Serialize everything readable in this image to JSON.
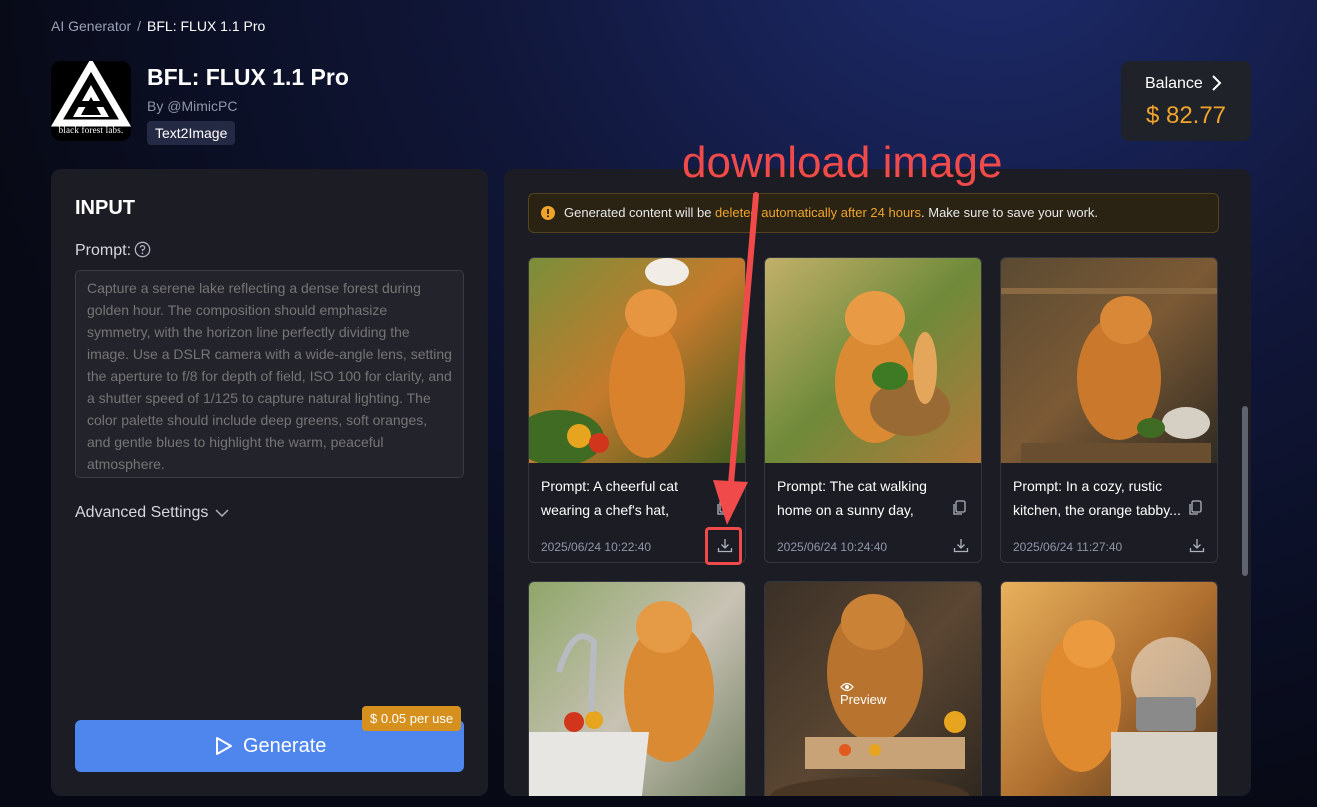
{
  "breadcrumb": {
    "parent": "AI Generator",
    "separator": "/",
    "current": "BFL: FLUX 1.1 Pro"
  },
  "app": {
    "title": "BFL: FLUX 1.1 Pro",
    "author": "By @MimicPC",
    "tag": "Text2Image",
    "logo_text": "black forest labs."
  },
  "balance": {
    "label": "Balance",
    "value": "$ 82.77",
    "icon": "chevron-right-icon"
  },
  "input": {
    "heading": "INPUT",
    "prompt_label": "Prompt:",
    "prompt_placeholder": "Capture a serene lake reflecting a dense forest during golden hour. The composition should emphasize symmetry, with the horizon line perfectly dividing the image. Use a DSLR camera with a wide-angle lens, setting the aperture to f/8 for depth of field, ISO 100 for clarity, and a shutter speed of 1/125 to capture natural lighting. The color palette should include deep greens, soft oranges, and gentle blues to highlight the warm, peaceful atmosphere.",
    "advanced_settings": "Advanced Settings",
    "generate_label": "Generate",
    "price_badge": "$ 0.05 per use"
  },
  "notice": {
    "prefix": "Generated content will be ",
    "highlight": "deleted automatically after 24 hours",
    "suffix": ". Make sure to save your work."
  },
  "cards": [
    {
      "prompt": "Prompt: A cheerful cat wearing a chef's hat, stan...",
      "date": "2025/06/24 10:22:40"
    },
    {
      "prompt": "Prompt: The cat walking home on a sunny day, bal-...",
      "date": "2025/06/24 10:24:40"
    },
    {
      "prompt": "Prompt: In a cozy, rustic kitchen, the orange tabby...",
      "date": "2025/06/24 11:27:40"
    }
  ],
  "preview_label": "Preview",
  "annotation": {
    "text": "download image",
    "color": "#f04a4a"
  },
  "colors": {
    "accent": "#4f86ee",
    "balance": "#f0a42a",
    "badge": "#d6901e",
    "panel": "#1c1d24"
  }
}
